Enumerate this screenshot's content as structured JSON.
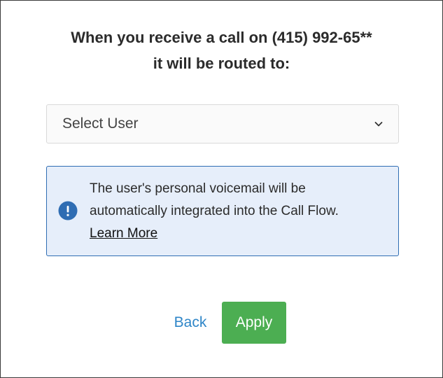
{
  "dialog": {
    "heading_line1": "When you receive a call on (415) 992-65**",
    "heading_line2": "it will be routed to:"
  },
  "user_select": {
    "selected_value": "Select User",
    "icon": "chevron-down-icon"
  },
  "info_box": {
    "icon": "exclamation-circle-icon",
    "line1": "The user's personal voicemail will be",
    "line2": "automatically integrated into the Call Flow.",
    "link_label": "Learn More"
  },
  "actions": {
    "back_label": "Back",
    "apply_label": "Apply"
  },
  "colors": {
    "apply_bg": "#4cae52",
    "back_text": "#2f86c8",
    "info_bg": "#e6eefa",
    "info_border": "#2f6db3",
    "info_icon": "#2f6db3"
  }
}
